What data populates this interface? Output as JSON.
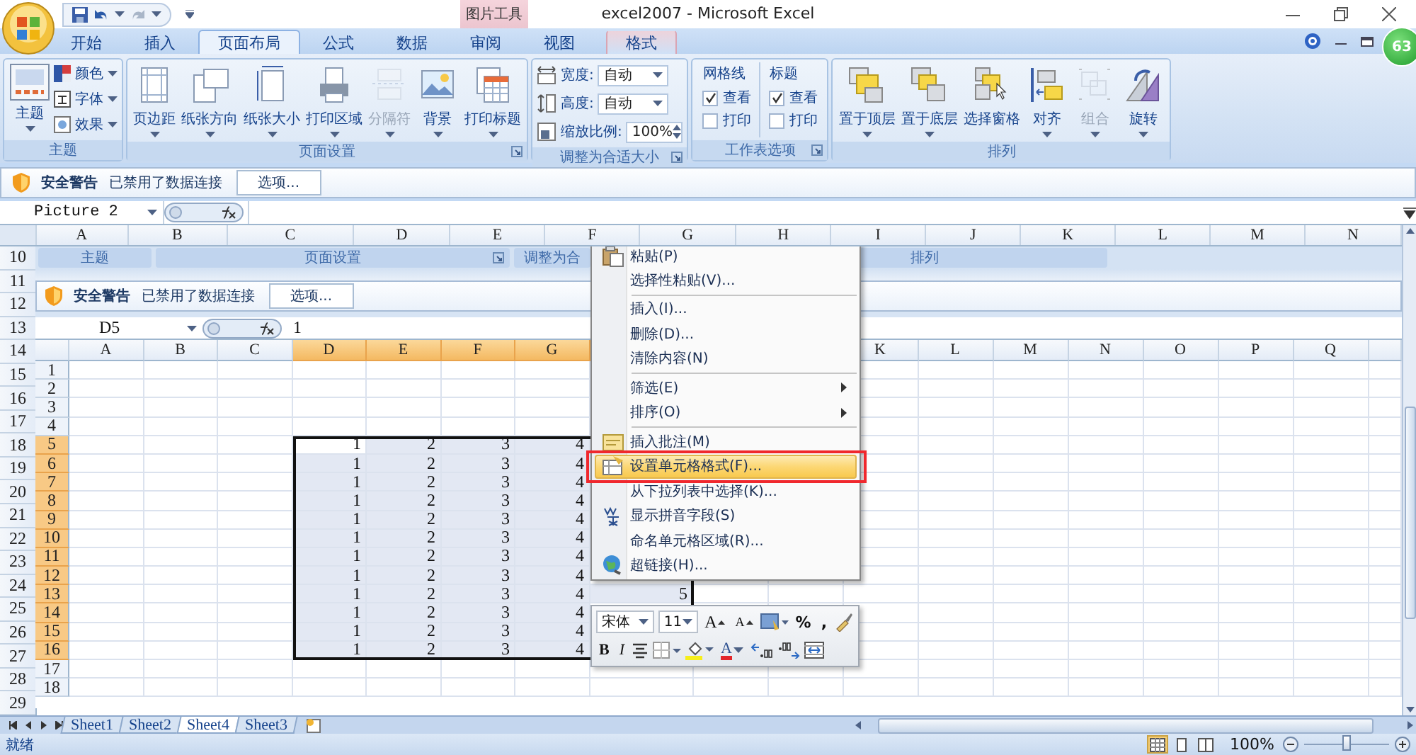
{
  "title_bar": {
    "title": "excel2007 - Microsoft Excel",
    "contextual_group": "图片工具",
    "badge": "63"
  },
  "tabs": [
    {
      "label": "开始",
      "selected": false,
      "contextual": false
    },
    {
      "label": "插入",
      "selected": false,
      "contextual": false
    },
    {
      "label": "页面布局",
      "selected": true,
      "contextual": false
    },
    {
      "label": "公式",
      "selected": false,
      "contextual": false
    },
    {
      "label": "数据",
      "selected": false,
      "contextual": false
    },
    {
      "label": "审阅",
      "selected": false,
      "contextual": false
    },
    {
      "label": "视图",
      "selected": false,
      "contextual": false
    },
    {
      "label": "格式",
      "selected": false,
      "contextual": true
    }
  ],
  "ribbon": {
    "groups": [
      {
        "kind": "theme",
        "label": "主题",
        "launcher": false,
        "big": {
          "label": "主题"
        },
        "small": [
          {
            "label": "颜色"
          },
          {
            "label": "字体"
          },
          {
            "label": "效果"
          }
        ]
      },
      {
        "kind": "buttons",
        "label": "页面设置",
        "launcher": true,
        "buttons": [
          {
            "label": "页边距",
            "disabled": false
          },
          {
            "label": "纸张方向",
            "disabled": false
          },
          {
            "label": "纸张大小",
            "disabled": false
          },
          {
            "label": "打印区域",
            "disabled": false
          },
          {
            "label": "分隔符",
            "disabled": true
          },
          {
            "label": "背景",
            "disabled": false
          },
          {
            "label": "打印标题",
            "disabled": false
          }
        ]
      },
      {
        "kind": "scale",
        "label": "调整为合适大小",
        "launcher": true,
        "fields": [
          {
            "label": "宽度:",
            "value": "自动",
            "kind": "dropdown"
          },
          {
            "label": "高度:",
            "value": "自动",
            "kind": "dropdown"
          },
          {
            "label": "缩放比例:",
            "value": "100%",
            "kind": "spinner"
          }
        ]
      },
      {
        "kind": "options",
        "label": "工作表选项",
        "launcher": true,
        "columns": [
          {
            "heading": "网格线",
            "checks": [
              {
                "label": "查看",
                "checked": true
              },
              {
                "label": "打印",
                "checked": false
              }
            ]
          },
          {
            "heading": "标题",
            "checks": [
              {
                "label": "查看",
                "checked": true
              },
              {
                "label": "打印",
                "checked": false
              }
            ]
          }
        ]
      },
      {
        "kind": "buttons",
        "label": "排列",
        "launcher": false,
        "buttons": [
          {
            "label": "置于顶层",
            "disabled": false
          },
          {
            "label": "置于底层",
            "disabled": false
          },
          {
            "label": "选择窗格",
            "disabled": false
          },
          {
            "label": "对齐",
            "disabled": false
          },
          {
            "label": "组合",
            "disabled": true
          },
          {
            "label": "旋转",
            "disabled": false
          }
        ]
      }
    ]
  },
  "security_bar": {
    "title": "安全警告",
    "message": "已禁用了数据连接",
    "button": "选项..."
  },
  "formula_bar": {
    "name_box": "Picture 2"
  },
  "sheet": {
    "columns": [
      "A",
      "B",
      "C",
      "D",
      "E",
      "F",
      "G",
      "H",
      "I",
      "J",
      "K",
      "L",
      "M",
      "N"
    ],
    "rows": [
      "10",
      "11",
      "12",
      "13",
      "14",
      "15",
      "16",
      "17",
      "18",
      "19",
      "20",
      "21",
      "22",
      "23",
      "24",
      "25",
      "26",
      "27",
      "28",
      "29"
    ]
  },
  "picture": {
    "group_labels": [
      {
        "label": "主题",
        "launcher": false
      },
      {
        "label": "页面设置",
        "launcher": true
      },
      {
        "label": "调整为合",
        "launcher": false
      },
      {
        "label": "排列",
        "launcher": false
      }
    ],
    "security_bar": {
      "title": "安全警告",
      "message": "已禁用了数据连接",
      "button": "选项..."
    },
    "formula_bar": {
      "name_box": "D5",
      "value": "1"
    },
    "columns_left": [
      {
        "label": "A",
        "selected": false
      },
      {
        "label": "B",
        "selected": false
      },
      {
        "label": "C",
        "selected": false
      },
      {
        "label": "D",
        "selected": true
      },
      {
        "label": "E",
        "selected": true
      },
      {
        "label": "F",
        "selected": true
      },
      {
        "label": "G",
        "selected": true
      }
    ],
    "columns_right": [
      {
        "label": "K",
        "selected": false
      },
      {
        "label": "L",
        "selected": false
      },
      {
        "label": "M",
        "selected": false
      },
      {
        "label": "N",
        "selected": false
      },
      {
        "label": "O",
        "selected": false
      },
      {
        "label": "P",
        "selected": false
      },
      {
        "label": "Q",
        "selected": false
      }
    ],
    "rows": [
      {
        "label": "1",
        "selected": false
      },
      {
        "label": "2",
        "selected": false
      },
      {
        "label": "3",
        "selected": false
      },
      {
        "label": "4",
        "selected": false
      },
      {
        "label": "5",
        "selected": true,
        "cells": [
          "1",
          "2",
          "3",
          "4"
        ]
      },
      {
        "label": "6",
        "selected": true,
        "cells": [
          "1",
          "2",
          "3",
          "4"
        ]
      },
      {
        "label": "7",
        "selected": true,
        "cells": [
          "1",
          "2",
          "3",
          "4"
        ]
      },
      {
        "label": "8",
        "selected": true,
        "cells": [
          "1",
          "2",
          "3",
          "4"
        ]
      },
      {
        "label": "9",
        "selected": true,
        "cells": [
          "1",
          "2",
          "3",
          "4"
        ]
      },
      {
        "label": "10",
        "selected": true,
        "cells": [
          "1",
          "2",
          "3",
          "4"
        ]
      },
      {
        "label": "11",
        "selected": true,
        "cells": [
          "1",
          "2",
          "3",
          "4"
        ]
      },
      {
        "label": "12",
        "selected": true,
        "cells": [
          "1",
          "2",
          "3",
          "4"
        ]
      },
      {
        "label": "13",
        "selected": true,
        "cells": [
          "1",
          "2",
          "3",
          "4",
          "5"
        ]
      },
      {
        "label": "14",
        "selected": true,
        "cells": [
          "1",
          "2",
          "3",
          "4"
        ]
      },
      {
        "label": "15",
        "selected": true,
        "cells": [
          "1",
          "2",
          "3",
          "4"
        ]
      },
      {
        "label": "16",
        "selected": true,
        "cells": [
          "1",
          "2",
          "3",
          "4"
        ]
      },
      {
        "label": "17",
        "selected": false
      },
      {
        "label": "18",
        "selected": false
      }
    ],
    "context_menu": [
      {
        "kind": "item",
        "label": "粘贴(P)",
        "selected": false
      },
      {
        "kind": "item",
        "label": "选择性粘贴(V)...",
        "selected": false
      },
      {
        "kind": "separator"
      },
      {
        "kind": "item",
        "label": "插入(I)...",
        "selected": false
      },
      {
        "kind": "item",
        "label": "删除(D)...",
        "selected": false
      },
      {
        "kind": "item",
        "label": "清除内容(N)",
        "selected": false
      },
      {
        "kind": "separator"
      },
      {
        "kind": "submenu",
        "label": "筛选(E)",
        "selected": false
      },
      {
        "kind": "submenu",
        "label": "排序(O)",
        "selected": false
      },
      {
        "kind": "separator"
      },
      {
        "kind": "item",
        "label": "插入批注(M)",
        "selected": false
      },
      {
        "kind": "item",
        "label": "设置单元格格式(F)...",
        "selected": true
      },
      {
        "kind": "item",
        "label": "从下拉列表中选择(K)...",
        "selected": false
      },
      {
        "kind": "item",
        "label": "显示拼音字段(S)",
        "selected": false
      },
      {
        "kind": "item",
        "label": "命名单元格区域(R)...",
        "selected": false
      },
      {
        "kind": "item",
        "label": "超链接(H)...",
        "selected": false
      }
    ],
    "mini_toolbar": {
      "font": "宋体",
      "size": "11",
      "rows": [
        [
          {
            "kind": "grow",
            "label": "A"
          },
          {
            "kind": "shrink",
            "label": "A"
          },
          {
            "kind": "styles"
          },
          {
            "kind": "text",
            "label": "%"
          },
          {
            "kind": "text",
            "label": ","
          },
          {
            "kind": "painter"
          }
        ],
        [
          {
            "kind": "bold",
            "label": "B"
          },
          {
            "kind": "italic",
            "label": "I"
          },
          {
            "kind": "align"
          },
          {
            "kind": "borders"
          },
          {
            "kind": "fill"
          },
          {
            "kind": "fontcolor",
            "label": "A"
          },
          {
            "kind": "decimal_more"
          },
          {
            "kind": "decimal_less"
          },
          {
            "kind": "merge"
          }
        ]
      ]
    }
  },
  "sheet_tabs": [
    {
      "label": "Sheet1",
      "selected": false
    },
    {
      "label": "Sheet2",
      "selected": false
    },
    {
      "label": "Sheet4",
      "selected": true
    },
    {
      "label": "Sheet3",
      "selected": false
    }
  ],
  "status_bar": {
    "status": "就绪",
    "views": [
      {
        "selected": true
      },
      {
        "selected": false
      },
      {
        "selected": false
      }
    ],
    "zoom": "100%",
    "zoom_slider": {
      "level": 0.5
    }
  }
}
